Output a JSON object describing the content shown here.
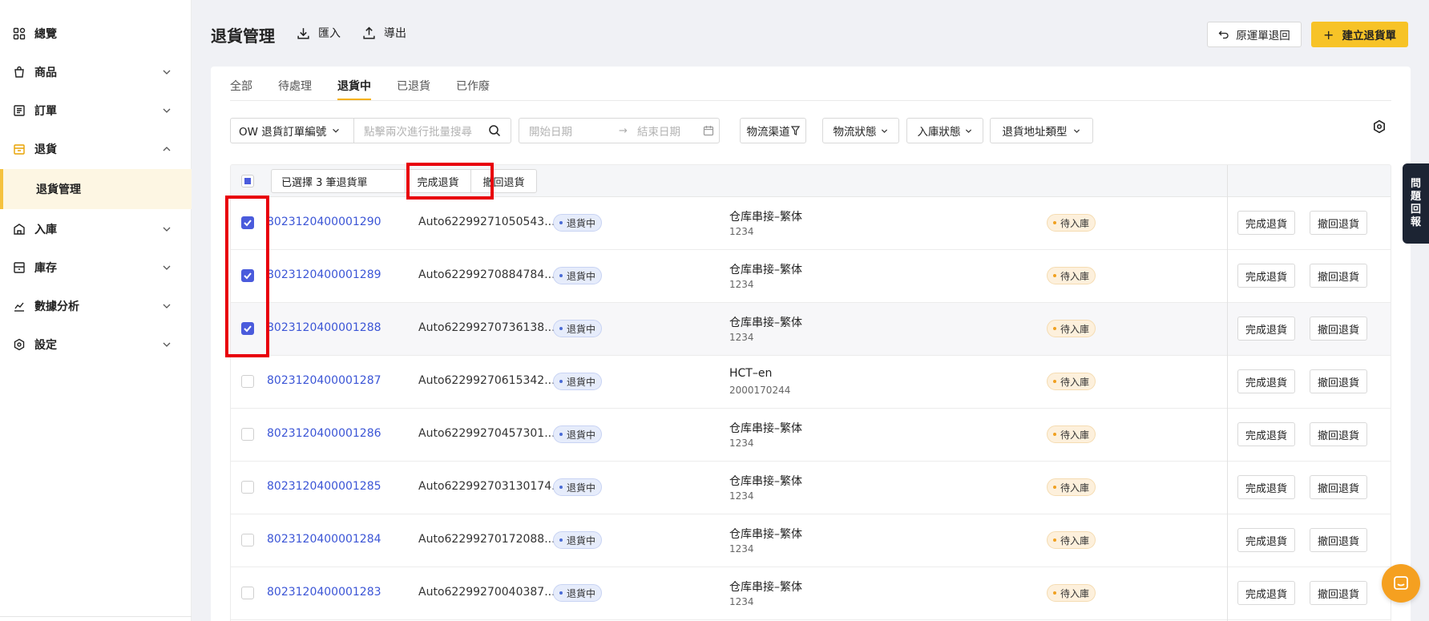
{
  "sidebar": {
    "items": [
      {
        "label": "總覽",
        "icon": "dashboard-icon"
      },
      {
        "label": "商品",
        "icon": "product-icon"
      },
      {
        "label": "訂單",
        "icon": "order-icon"
      },
      {
        "label": "退貨",
        "icon": "return-icon"
      },
      {
        "label": "入庫",
        "icon": "inbound-icon"
      },
      {
        "label": "庫存",
        "icon": "inventory-icon"
      },
      {
        "label": "數據分析",
        "icon": "analytics-icon"
      },
      {
        "label": "設定",
        "icon": "settings-icon"
      }
    ],
    "sub_active": "退貨管理"
  },
  "header": {
    "title": "退貨管理",
    "import_label": "匯入",
    "export_label": "導出",
    "original_return_label": "原運單退回",
    "create_label": "建立退貨單"
  },
  "tabs": [
    "全部",
    "待處理",
    "退貨中",
    "已退貨",
    "已作廢"
  ],
  "active_tab": "退貨中",
  "filters": {
    "search_type": "OW 退貨訂單編號",
    "search_placeholder": "點擊兩次進行批量搜尋",
    "start_date_placeholder": "開始日期",
    "end_date_placeholder": "結束日期",
    "date_separator": "→",
    "dropdowns": [
      "物流渠道",
      "物流狀態",
      "入庫狀態",
      "退貨地址類型"
    ]
  },
  "bulk": {
    "selected_text": "已選擇 3 筆退貨單",
    "complete_label": "完成退貨",
    "revoke_label": "撤回退貨"
  },
  "rows": [
    {
      "order": "8023120400001290",
      "ref": "Auto62299271050543...",
      "status": "退貨中",
      "carrier": "仓库串接–繁体",
      "carrier_code": "1234",
      "inbound": "待入庫",
      "checked": true
    },
    {
      "order": "8023120400001289",
      "ref": "Auto62299270884784...",
      "status": "退貨中",
      "carrier": "仓库串接–繁体",
      "carrier_code": "1234",
      "inbound": "待入庫",
      "checked": true
    },
    {
      "order": "8023120400001288",
      "ref": "Auto62299270736138...",
      "status": "退貨中",
      "carrier": "仓库串接–繁体",
      "carrier_code": "1234",
      "inbound": "待入庫",
      "checked": true
    },
    {
      "order": "8023120400001287",
      "ref": "Auto62299270615342...",
      "status": "退貨中",
      "carrier": "HCT–en",
      "carrier_code": "2000170244",
      "inbound": "待入庫",
      "checked": false
    },
    {
      "order": "8023120400001286",
      "ref": "Auto62299270457301...",
      "status": "退貨中",
      "carrier": "仓库串接–繁体",
      "carrier_code": "1234",
      "inbound": "待入庫",
      "checked": false
    },
    {
      "order": "8023120400001285",
      "ref": "Auto622992703130174...",
      "status": "退貨中",
      "carrier": "仓库串接–繁体",
      "carrier_code": "1234",
      "inbound": "待入庫",
      "checked": false
    },
    {
      "order": "8023120400001284",
      "ref": "Auto62299270172088...",
      "status": "退貨中",
      "carrier": "仓库串接–繁体",
      "carrier_code": "1234",
      "inbound": "待入庫",
      "checked": false
    },
    {
      "order": "8023120400001283",
      "ref": "Auto62299270040387...",
      "status": "退貨中",
      "carrier": "仓库串接–繁体",
      "carrier_code": "1234",
      "inbound": "待入庫",
      "checked": false
    }
  ],
  "row_actions": {
    "complete": "完成退貨",
    "revoke": "撤回退貨"
  },
  "side_tab_label": [
    "問",
    "題",
    "回",
    "報"
  ],
  "colors": {
    "accent": "#f7c327",
    "link": "#3b55d6",
    "checkbox": "#4a5bdc",
    "annotation": "#e8000b"
  }
}
